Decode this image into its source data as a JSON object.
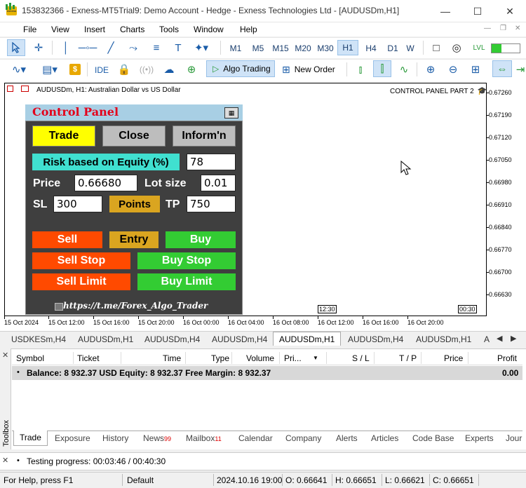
{
  "window": {
    "title": "153832366 - Exness-MT5Trial9: Demo Account - Hedge - Exness Technologies Ltd - [AUDUSDm,H1]",
    "app_icon_label": "exness",
    "controls": [
      "minimize-icon",
      "maximize-icon",
      "close-icon"
    ]
  },
  "menu": {
    "items": [
      "File",
      "View",
      "Insert",
      "Charts",
      "Tools",
      "Window",
      "Help"
    ]
  },
  "toolbar1": {
    "timeframes": [
      "M1",
      "M5",
      "M15",
      "M20",
      "M30",
      "H1",
      "H4",
      "D1",
      "W"
    ],
    "selected_timeframe": "H1"
  },
  "toolbar2": {
    "ide_label": "IDE",
    "algo_trading_label": "Algo Trading",
    "new_order_label": "New Order"
  },
  "chart": {
    "symbol_text": "AUDUSDm, H1:  Australian Dollar vs US Dollar",
    "panel_name": "CONTROL PANEL PART 2",
    "price_ticks": [
      "0.67260",
      "0.67190",
      "0.67120",
      "0.67050",
      "0.66980",
      "0.66910",
      "0.66840",
      "0.66770",
      "0.66700",
      "0.66630"
    ],
    "time_ticks": [
      "15 Oct 2024",
      "15 Oct 12:00",
      "15 Oct 16:00",
      "15 Oct 20:00",
      "16 Oct 00:00",
      "16 Oct 04:00",
      "16 Oct 08:00",
      "16 Oct 12:00",
      "16 Oct 16:00",
      "16 Oct 20:00"
    ],
    "time_markers": [
      "12:30",
      "00:30"
    ]
  },
  "control_panel": {
    "title": "Control Panel",
    "tabs": [
      "Trade",
      "Close",
      "Inform'n"
    ],
    "risk_label": "Risk based on Equity (%)",
    "risk_value": "78",
    "price_label": "Price",
    "price_value": "0.66680",
    "lot_label": "Lot size",
    "lot_value": "0.01",
    "sl_label": "SL",
    "sl_value": "300",
    "points_label": "Points",
    "tp_label": "TP",
    "tp_value": "750",
    "sell_label": "Sell",
    "entry_label": "Entry",
    "buy_label": "Buy",
    "sell_stop_label": "Sell Stop",
    "buy_stop_label": "Buy Stop",
    "sell_limit_label": "Sell Limit",
    "buy_limit_label": "Buy Limit",
    "footer": "https://t.me/Forex_Algo_Trader",
    "colors": {
      "header_bg": "#a8cfe4",
      "title": "#e4001a",
      "body_bg": "#3f3f3f",
      "trade_tab": "#ffff00",
      "inactive_tab": "#bdbdbd",
      "risk_label_bg": "#40e0d0",
      "points_bg": "#daa520",
      "sell": "#ff4a00",
      "entry": "#daa520",
      "buy": "#33cc33"
    }
  },
  "chart_tabs": {
    "items": [
      "USDKESm,H4",
      "AUDUSDm,H1",
      "AUDUSDm,H4",
      "AUDUSDm,H4",
      "AUDUSDm,H1",
      "AUDUSDm,H4",
      "AUDUSDm,H1",
      "A"
    ],
    "active_index": 4
  },
  "toolbox": {
    "side_label": "Toolbox",
    "columns": [
      "Symbol",
      "Ticket",
      "Time",
      "Type",
      "Volume",
      "Pri...",
      "S / L",
      "T / P",
      "Price",
      "Profit"
    ],
    "balance_text": "Balance: 8 932.37 USD  Equity: 8 932.37  Free Margin: 8 932.37",
    "balance_profit": "0.00",
    "tabs": [
      "Trade",
      "Exposure",
      "History",
      "News",
      "Mailbox",
      "Calendar",
      "Company",
      "Alerts",
      "Articles",
      "Code Base",
      "Experts",
      "Jour"
    ],
    "news_count": "99",
    "mailbox_count": "11",
    "active_tab": "Trade"
  },
  "testing": {
    "text": "Testing progress: 00:03:46 / 00:40:30"
  },
  "statusbar": {
    "help": "For Help, press F1",
    "profile": "Default",
    "datetime": "2024.10.16 19:00",
    "open": "O: 0.66641",
    "high": "H: 0.66651",
    "low": "L: 0.66621",
    "close": "C: 0.66651"
  }
}
